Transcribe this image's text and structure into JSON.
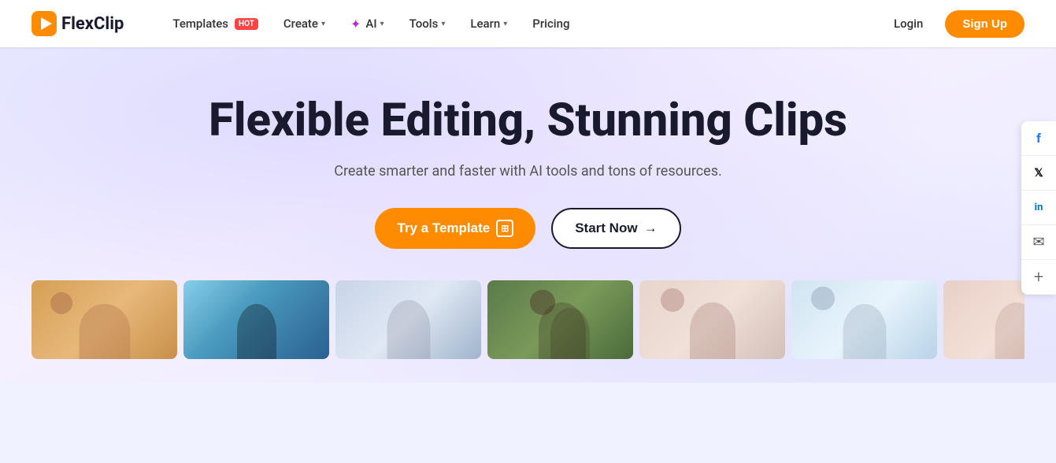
{
  "brand": {
    "name": "FlexClip",
    "logo_text": "FlexClip"
  },
  "nav": {
    "items": [
      {
        "label": "Templates",
        "badge": "HOT",
        "has_dropdown": false
      },
      {
        "label": "Create",
        "has_dropdown": true
      },
      {
        "label": "AI",
        "has_dropdown": true,
        "has_star": true
      },
      {
        "label": "Tools",
        "has_dropdown": true
      },
      {
        "label": "Learn",
        "has_dropdown": true
      },
      {
        "label": "Pricing",
        "has_dropdown": false
      }
    ],
    "login_label": "Login",
    "signup_label": "Sign Up"
  },
  "hero": {
    "title": "Flexible Editing, Stunning Clips",
    "subtitle": "Create smarter and faster with AI tools and tons of resources.",
    "btn_template": "Try a Template",
    "btn_start": "Start Now",
    "arrow": "→"
  },
  "social": {
    "items": [
      {
        "name": "facebook",
        "icon": "f"
      },
      {
        "name": "twitter",
        "icon": "𝕏"
      },
      {
        "name": "linkedin",
        "icon": "in"
      },
      {
        "name": "email",
        "icon": "✉"
      },
      {
        "name": "plus",
        "icon": "+"
      }
    ]
  }
}
